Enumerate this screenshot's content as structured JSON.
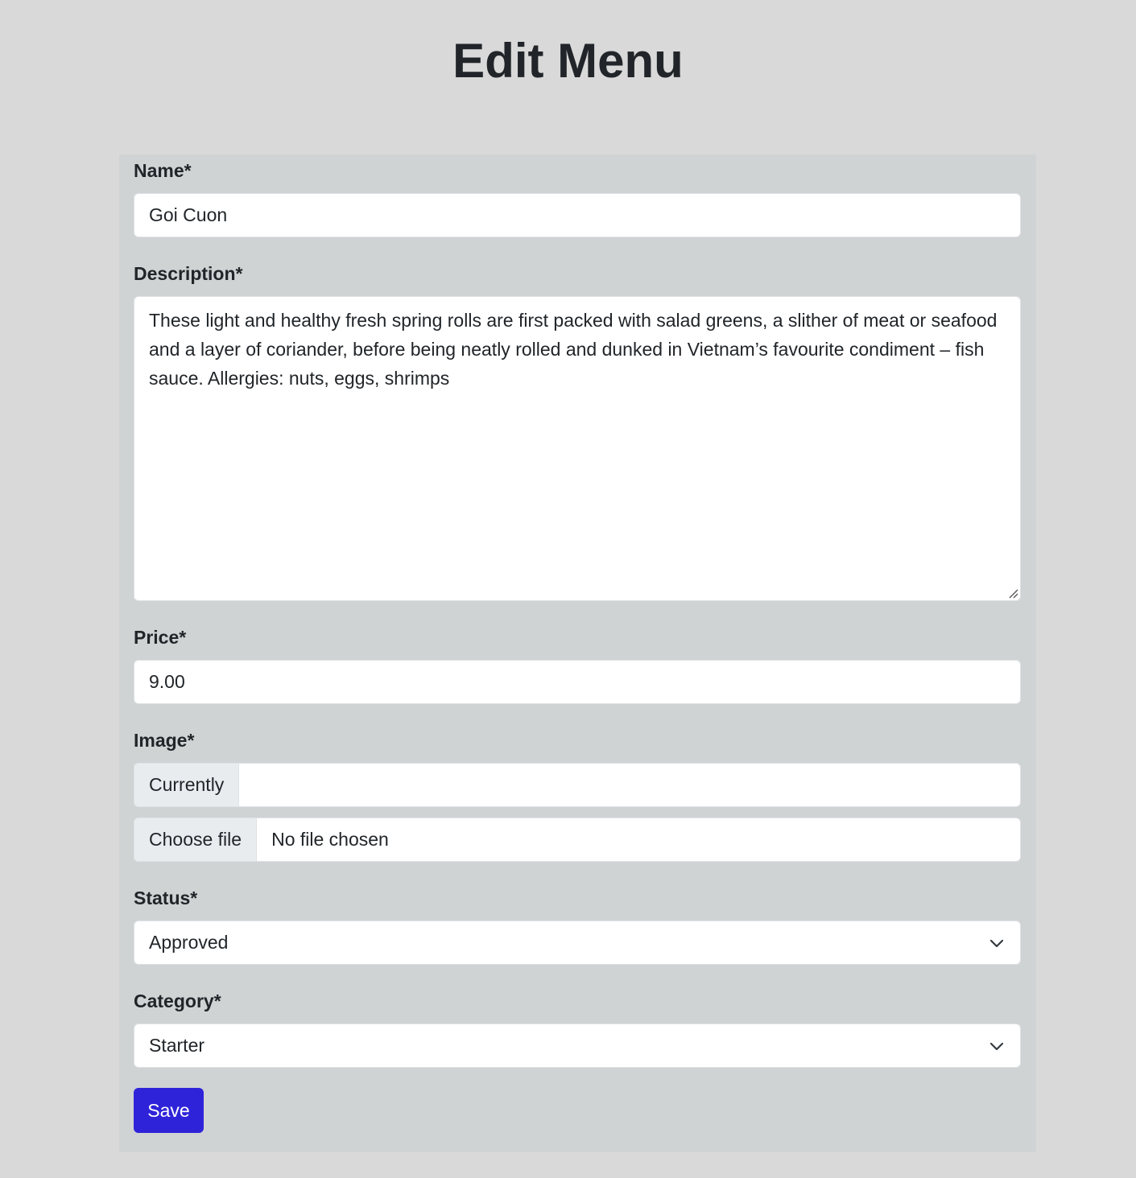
{
  "page": {
    "title": "Edit Menu"
  },
  "form": {
    "name": {
      "label": "Name*",
      "value": "Goi Cuon"
    },
    "description": {
      "label": "Description*",
      "value": "These light and healthy fresh spring rolls are first packed with salad greens, a slither of meat or seafood and a layer of coriander, before being neatly rolled and dunked in Vietnam’s favourite condiment – fish sauce. Allergies: nuts, eggs, shrimps"
    },
    "price": {
      "label": "Price*",
      "value": "9.00"
    },
    "image": {
      "label": "Image*",
      "currently_label": "Currently",
      "currently_value": "",
      "choose_file_label": "Choose file",
      "file_status": "No file chosen"
    },
    "status": {
      "label": "Status*",
      "selected": "Approved"
    },
    "category": {
      "label": "Category*",
      "selected": "Starter"
    },
    "save_label": "Save"
  },
  "colors": {
    "page_background": "#d9d9d9",
    "panel_background": "#d0d3d4",
    "primary_button": "#2f23d9",
    "addon_background": "#e9ecef",
    "text": "#212529"
  },
  "icons": {
    "select_indicator": "chevron-down-icon",
    "textarea_resize": "resize-handle-icon"
  }
}
